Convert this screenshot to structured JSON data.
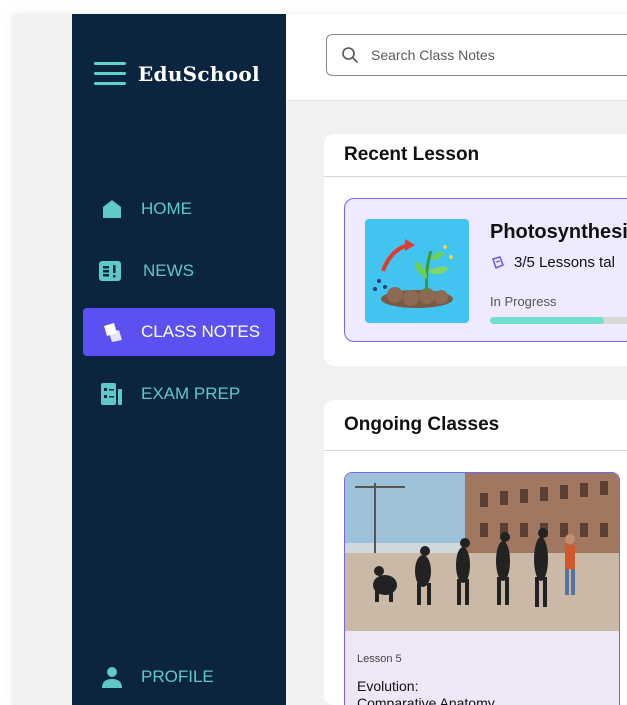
{
  "brand": {
    "name": "EduSchool"
  },
  "sidebar": {
    "items": [
      {
        "label": "HOME",
        "icon": "home-icon",
        "active": false
      },
      {
        "label": "NEWS",
        "icon": "news-icon",
        "active": false
      },
      {
        "label": "CLASS NOTES",
        "icon": "class-notes-icon",
        "active": true
      },
      {
        "label": "EXAM PREP",
        "icon": "exam-prep-icon",
        "active": false
      }
    ],
    "profile": {
      "label": "PROFILE",
      "icon": "profile-icon"
    }
  },
  "search": {
    "placeholder": "Search Class Notes"
  },
  "recent_lesson": {
    "heading": "Recent Lesson",
    "title": "Photosynthesi",
    "progress_text": "3/5 Lessons tal",
    "status": "In Progress",
    "progress": 0.6
  },
  "ongoing_classes": {
    "heading": "Ongoing Classes",
    "card": {
      "lesson": "Lesson 5",
      "title": "Evolution:",
      "subtitle": "Comparative Anatomy"
    }
  },
  "colors": {
    "sidebar_bg": "#0b2540",
    "accent": "#5b50f0",
    "teal": "#5ec9c6",
    "progress": "#6fe0cf"
  }
}
